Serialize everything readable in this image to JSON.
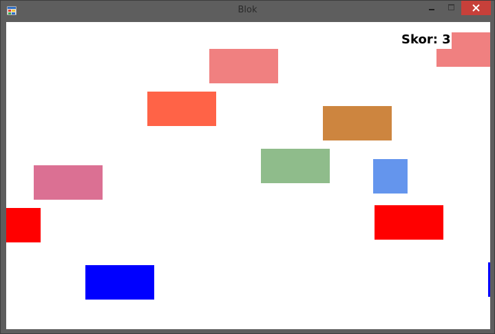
{
  "window": {
    "title": "Blok"
  },
  "game": {
    "score_label": "Skor: 3",
    "blocks": [
      {
        "id": "block-1",
        "color": "#f08080"
      },
      {
        "id": "block-2",
        "color": "#f08080"
      },
      {
        "id": "block-3",
        "color": "#ff6347"
      },
      {
        "id": "block-4",
        "color": "#cd853f"
      },
      {
        "id": "block-5",
        "color": "#8fbc8b"
      },
      {
        "id": "block-6",
        "color": "#db7093"
      },
      {
        "id": "block-7",
        "color": "#6495ed"
      },
      {
        "id": "block-8",
        "color": "#ff0000"
      },
      {
        "id": "block-9",
        "color": "#ff0000"
      },
      {
        "id": "block-10",
        "color": "#0000ff"
      },
      {
        "id": "block-11",
        "color": "#0000ff"
      }
    ]
  }
}
